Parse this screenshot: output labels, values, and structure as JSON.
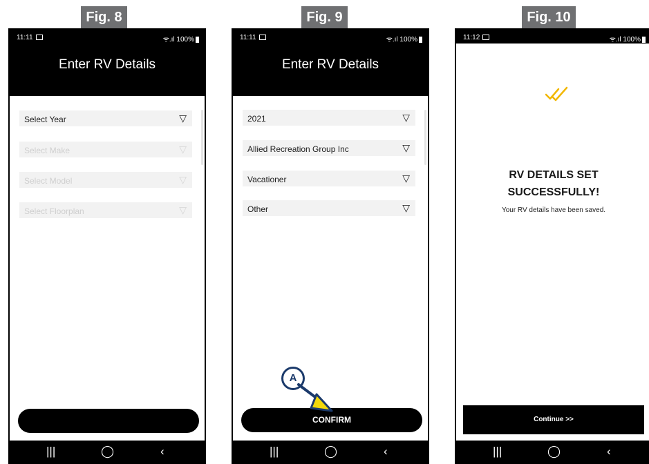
{
  "figures": [
    {
      "tag": "Fig. 8",
      "status": {
        "time": "11:11",
        "right": "ᯤ.ıl 100%"
      },
      "title": "Enter RV Details",
      "dropdowns": [
        {
          "label": "Select Year",
          "disabled": false
        },
        {
          "label": "Select Make",
          "disabled": true
        },
        {
          "label": "Select Model",
          "disabled": true
        },
        {
          "label": "Select Floorplan",
          "disabled": true
        }
      ],
      "button_label": ""
    },
    {
      "tag": "Fig. 9",
      "status": {
        "time": "11:11",
        "right": "ᯤ.ıl 100%"
      },
      "title": "Enter RV Details",
      "dropdowns": [
        {
          "label": "2021",
          "disabled": false
        },
        {
          "label": "Allied Recreation Group Inc",
          "disabled": false
        },
        {
          "label": "Vacationer",
          "disabled": false
        },
        {
          "label": "Other",
          "disabled": false
        }
      ],
      "button_label": "CONFIRM",
      "callout": "A"
    },
    {
      "tag": "Fig. 10",
      "status": {
        "time": "11:12",
        "right": "ᯤ.ıl 100%"
      },
      "success_title_line1": "RV DETAILS SET",
      "success_title_line2": "SUCCESSFULLY!",
      "success_sub": "Your RV details have been saved.",
      "button_label": "Continue >>"
    }
  ],
  "nav": {
    "recents": "|||",
    "home": "◯",
    "back": "‹"
  },
  "dropdown_arrow": "▽",
  "icons": {
    "dropdown": "triangle-down-outline-icon",
    "check": "double-check-icon",
    "callout_arrow": "pointer-arrow-icon"
  },
  "colors": {
    "fig_tag_bg": "#6f7072",
    "callout": "#1b3a6b",
    "arrow_fill": "#f2d80a",
    "check": "#f2b700"
  }
}
